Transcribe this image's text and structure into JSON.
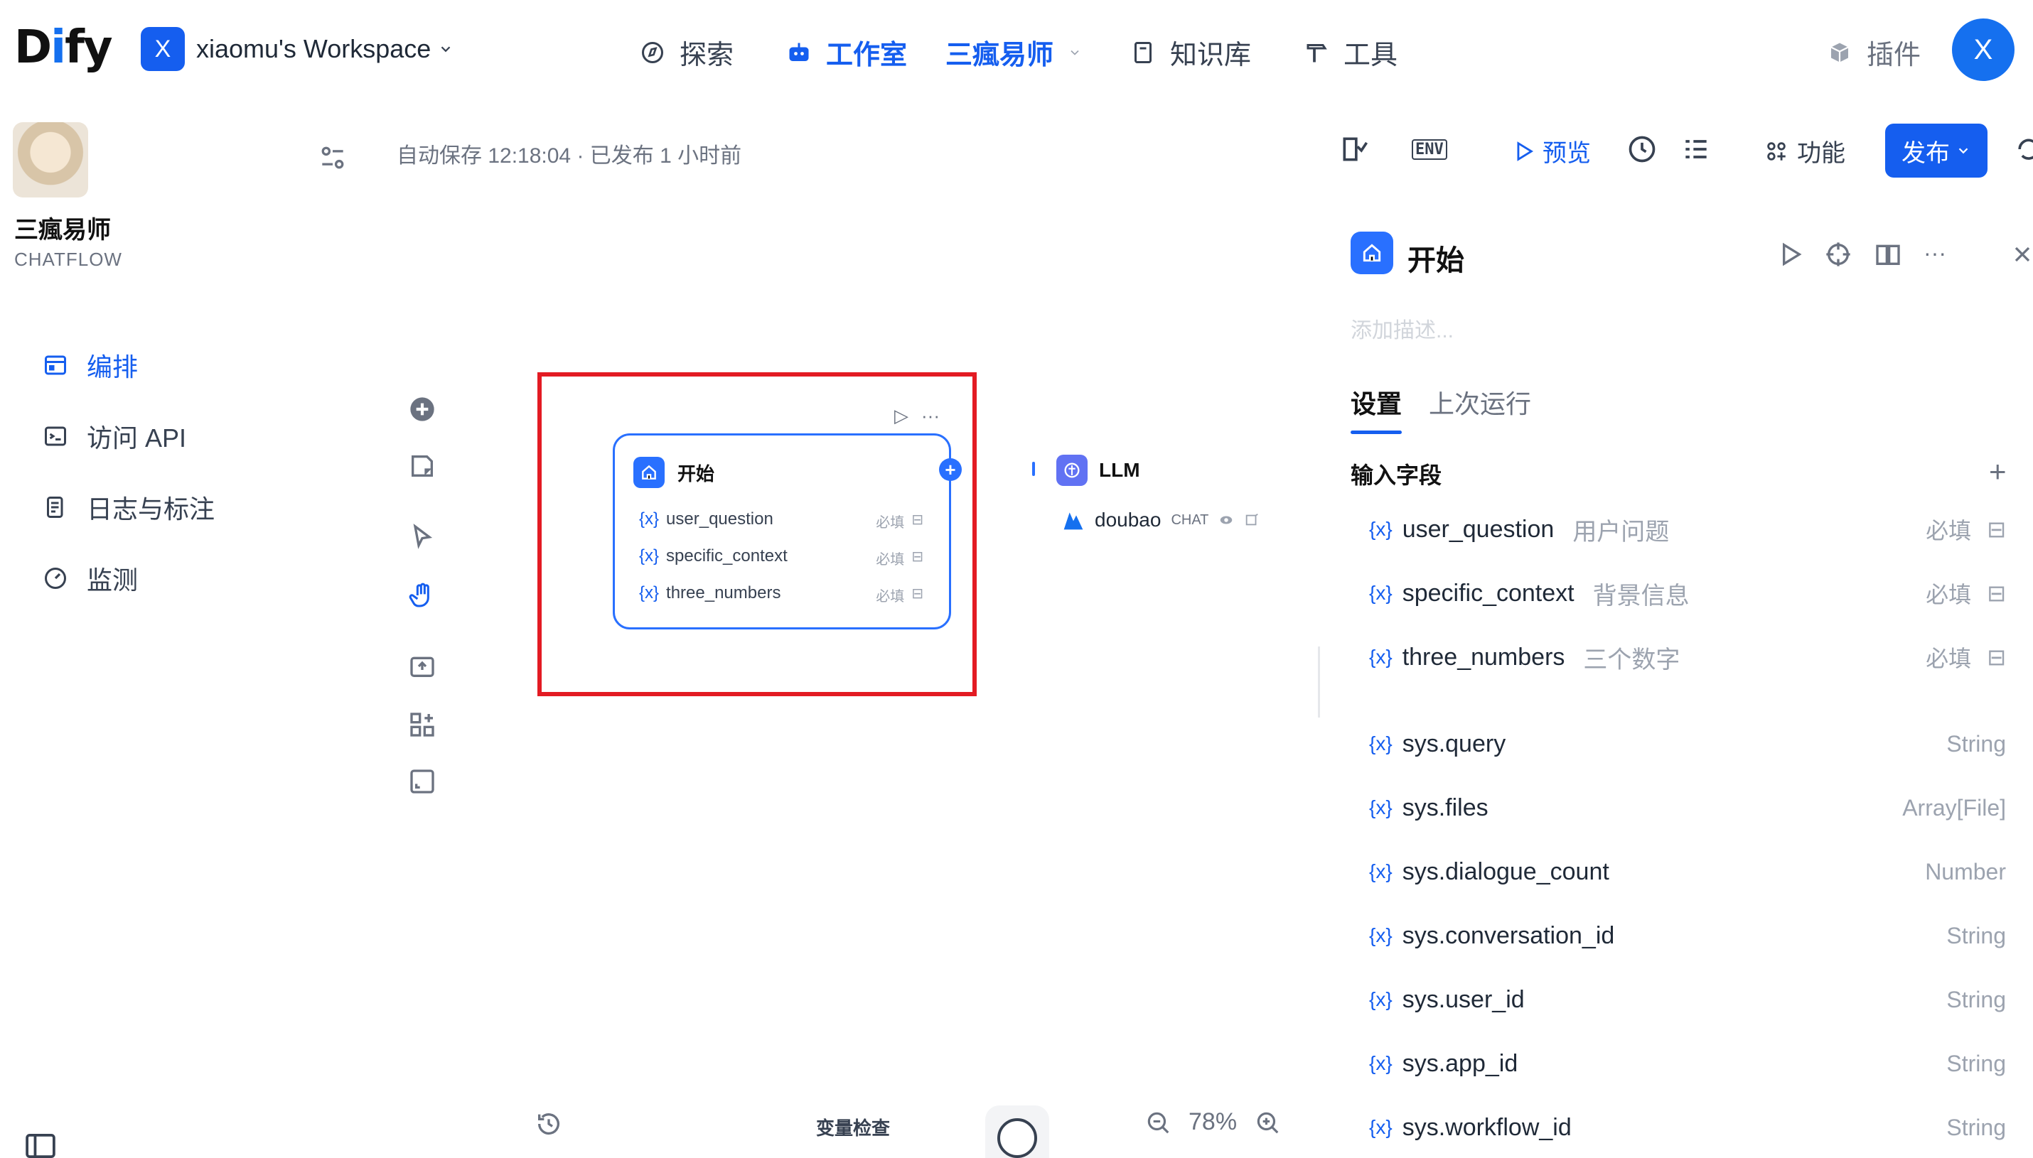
{
  "brand": {
    "logo": "Dify"
  },
  "workspace": {
    "avatar_letter": "X",
    "name": "xiaomu's Workspace"
  },
  "nav": {
    "explore": "探索",
    "studio": "工作室",
    "app": "三瘋易师",
    "knowledge": "知识库",
    "tools": "工具",
    "plugins": "插件"
  },
  "user": {
    "avatar_letter": "X"
  },
  "app": {
    "name": "三瘋易师",
    "type": "CHATFLOW"
  },
  "sidebar": {
    "items": [
      {
        "label": "编排",
        "icon": "layout-icon"
      },
      {
        "label": "访问 API",
        "icon": "terminal-icon"
      },
      {
        "label": "日志与标注",
        "icon": "log-icon"
      },
      {
        "label": "监测",
        "icon": "gauge-icon"
      }
    ]
  },
  "toolbar": {
    "autosave": "自动保存 12:18:04 · 已发布 1 小时前",
    "env": "ENV",
    "preview": "预览",
    "feature": "功能",
    "publish": "发布"
  },
  "start_node": {
    "title": "开始",
    "vars": [
      {
        "name": "user_question",
        "required": "必填"
      },
      {
        "name": "specific_context",
        "required": "必填"
      },
      {
        "name": "three_numbers",
        "required": "必填"
      }
    ]
  },
  "llm_node": {
    "title": "LLM",
    "model": "doubao",
    "mode": "CHAT"
  },
  "bottom": {
    "var_check": "变量检查",
    "zoom": "78%"
  },
  "panel": {
    "title": "开始",
    "desc_placeholder": "添加描述...",
    "tabs": [
      "设置",
      "上次运行"
    ],
    "section": "输入字段",
    "inputs": [
      {
        "name": "user_question",
        "label": "用户问题",
        "required": "必填"
      },
      {
        "name": "specific_context",
        "label": "背景信息",
        "required": "必填"
      },
      {
        "name": "three_numbers",
        "label": "三个数字",
        "required": "必填"
      }
    ],
    "sys": [
      {
        "name": "sys.query",
        "type": "String"
      },
      {
        "name": "sys.files",
        "type": "Array[File]"
      },
      {
        "name": "sys.dialogue_count",
        "type": "Number"
      },
      {
        "name": "sys.conversation_id",
        "type": "String"
      },
      {
        "name": "sys.user_id",
        "type": "String"
      },
      {
        "name": "sys.app_id",
        "type": "String"
      },
      {
        "name": "sys.workflow_id",
        "type": "String"
      }
    ],
    "var_prefix": "{x}"
  }
}
